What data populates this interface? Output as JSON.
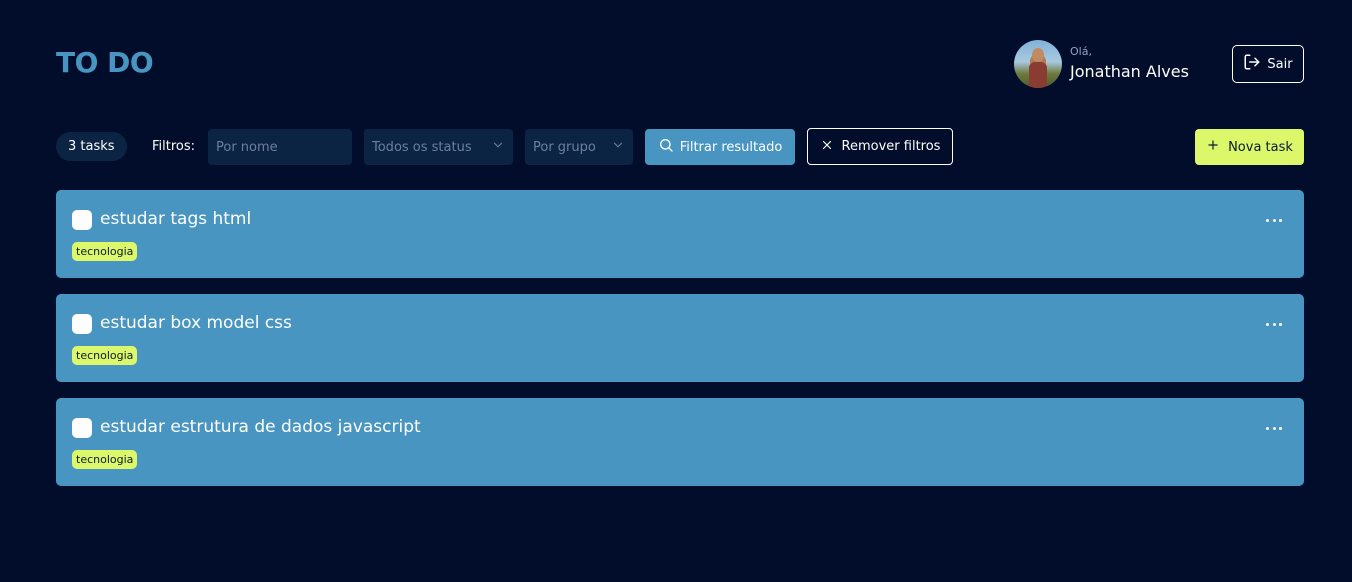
{
  "header": {
    "logo": "TO DO",
    "greeting": "Olá,",
    "user_name": "Jonathan Alves",
    "logout_label": "Sair"
  },
  "filters": {
    "task_count": "3 tasks",
    "label": "Filtros:",
    "name_placeholder": "Por nome",
    "status_value": "Todos os status",
    "group_value": "Por grupo",
    "apply_label": "Filtrar resultado",
    "remove_label": "Remover filtros",
    "new_task_label": "Nova task"
  },
  "tasks": [
    {
      "title": "estudar tags html",
      "tag": "tecnologia"
    },
    {
      "title": "estudar box model css",
      "tag": "tecnologia"
    },
    {
      "title": "estudar estrutura de dados javascript",
      "tag": "tecnologia"
    }
  ],
  "colors": {
    "background": "#010d2b",
    "primary": "#4895c2",
    "accent": "#ddf76b",
    "input_bg": "#0c2444"
  }
}
